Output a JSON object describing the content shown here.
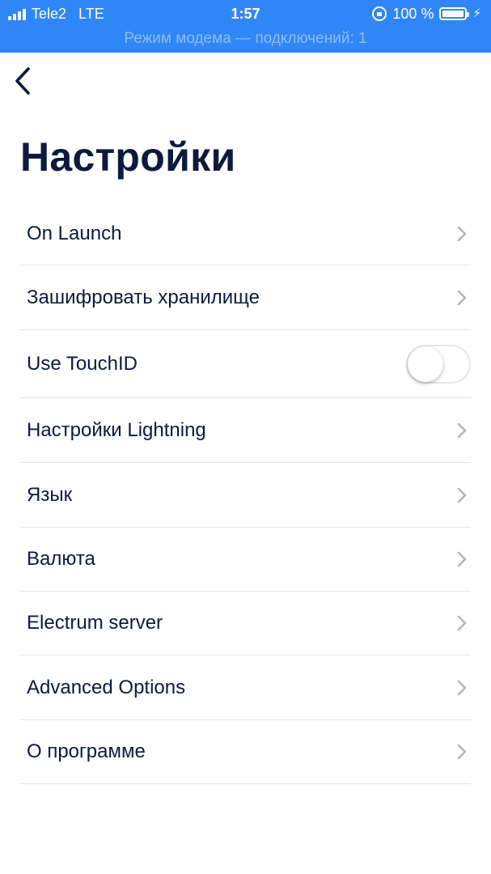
{
  "status_bar": {
    "carrier": "Tele2",
    "network": "LTE",
    "time": "1:57",
    "battery_percent": "100 %",
    "battery_level": 1.0,
    "hotspot_text": "Режим модема — подключений: 1",
    "icons": [
      "signal-icon",
      "orientation-lock-icon",
      "battery-icon",
      "charging-bolt-icon"
    ],
    "background_color": "#2f86f6"
  },
  "nav": {
    "back_icon": "chevron-left-icon"
  },
  "page": {
    "title": "Настройки"
  },
  "settings": {
    "items": [
      {
        "label": "On Launch",
        "control": "chevron"
      },
      {
        "label": "Зашифровать хранилище",
        "control": "chevron"
      },
      {
        "label": "Use TouchID",
        "control": "toggle",
        "toggle_on": false
      },
      {
        "label": "Настройки Lightning",
        "control": "chevron"
      },
      {
        "label": "Язык",
        "control": "chevron"
      },
      {
        "label": "Валюта",
        "control": "chevron"
      },
      {
        "label": "Electrum server",
        "control": "chevron"
      },
      {
        "label": "Advanced Options",
        "control": "chevron"
      },
      {
        "label": "О программе",
        "control": "chevron"
      }
    ]
  },
  "colors": {
    "title": "#0c1a3e",
    "divider": "#e4e4e6",
    "chevron": "#b5b5ba"
  }
}
